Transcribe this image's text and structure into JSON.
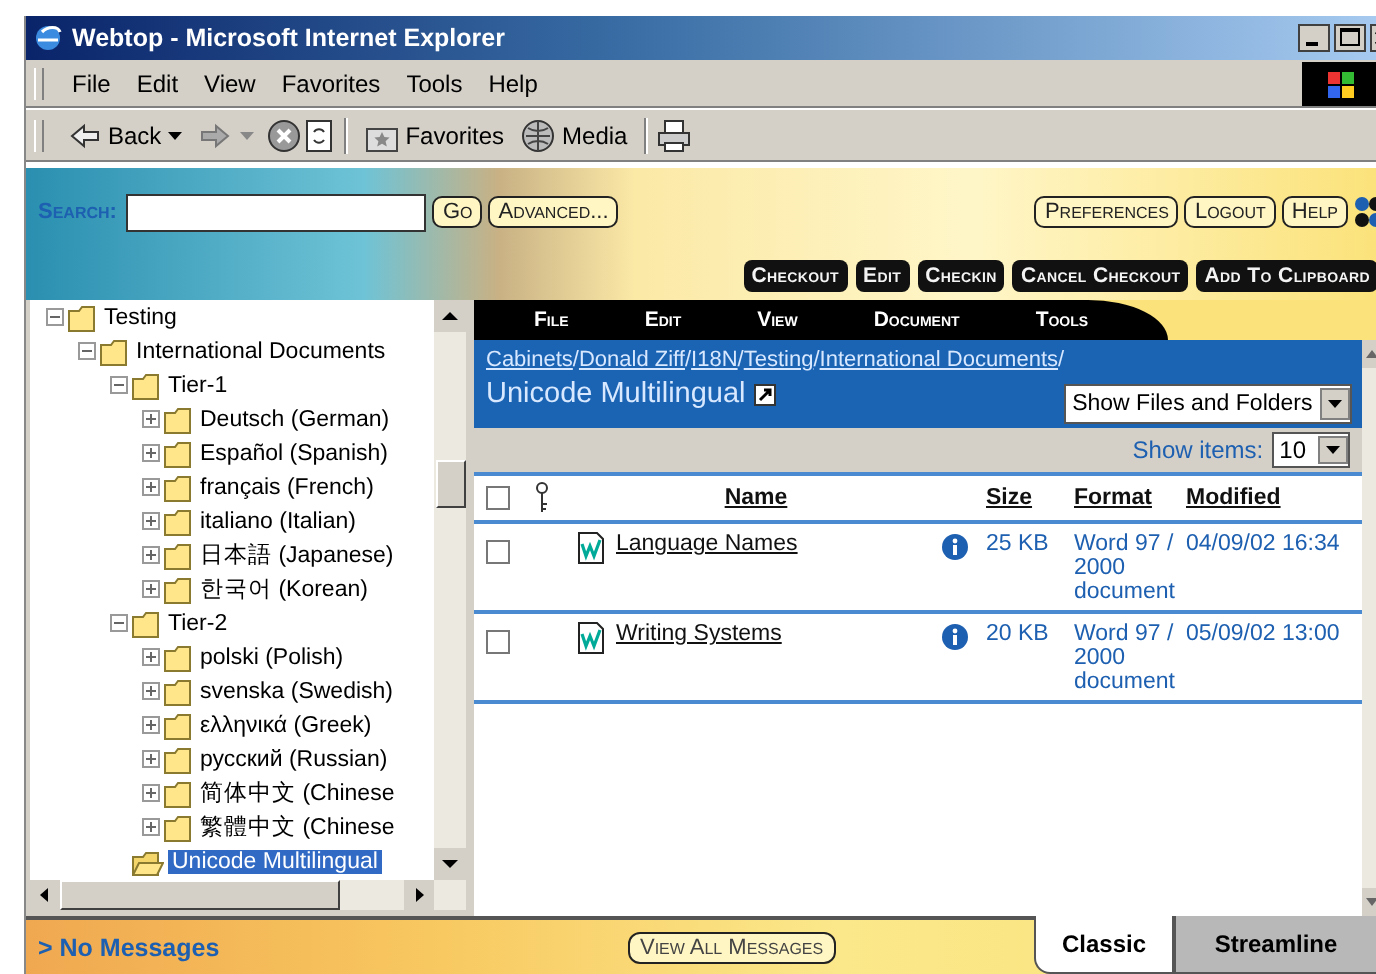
{
  "window": {
    "title": "Webtop - Microsoft Internet Explorer"
  },
  "menu_bar": [
    "File",
    "Edit",
    "View",
    "Favorites",
    "Tools",
    "Help"
  ],
  "toolbar": [
    {
      "kind": "back",
      "label": "Back"
    },
    {
      "kind": "forward"
    },
    {
      "kind": "stop"
    },
    {
      "kind": "refresh"
    },
    {
      "kind": "favorites",
      "label": "Favorites"
    },
    {
      "kind": "media",
      "label": "Media"
    },
    {
      "kind": "print"
    }
  ],
  "header": {
    "search": {
      "label": "Search:",
      "button": "Go",
      "advanced": "Advanced..."
    },
    "links": [
      "Preferences",
      "Logout",
      "Help"
    ],
    "actions": [
      "Checkout",
      "Edit",
      "Checkin",
      "Cancel Checkout",
      "Add To Clipboard"
    ]
  },
  "tree": [
    {
      "label": "Testing",
      "kind": "folder",
      "expanded": true,
      "selected": false,
      "children": [
        {
          "label": "International Documents",
          "kind": "folder",
          "expanded": true,
          "selected": false,
          "children": [
            {
              "label": "Tier-1",
              "kind": "folder",
              "expanded": true,
              "selected": false,
              "children": [
                {
                  "label": "Deutsch (German)",
                  "kind": "folder",
                  "expanded": false,
                  "selected": false
                },
                {
                  "label": "Español (Spanish)",
                  "kind": "folder",
                  "expanded": false,
                  "selected": false
                },
                {
                  "label": "français (French)",
                  "kind": "folder",
                  "expanded": false,
                  "selected": false
                },
                {
                  "label": "italiano (Italian)",
                  "kind": "folder",
                  "expanded": false,
                  "selected": false
                },
                {
                  "label": "日本語 (Japanese)",
                  "kind": "folder",
                  "expanded": false,
                  "selected": false
                },
                {
                  "label": "한국어 (Korean)",
                  "kind": "folder",
                  "expanded": false,
                  "selected": false
                }
              ]
            },
            {
              "label": "Tier-2",
              "kind": "folder",
              "expanded": true,
              "selected": false,
              "children": [
                {
                  "label": "polski (Polish)",
                  "kind": "folder",
                  "expanded": false,
                  "selected": false
                },
                {
                  "label": "svenska (Swedish)",
                  "kind": "folder",
                  "expanded": false,
                  "selected": false
                },
                {
                  "label": "ελληνικά (Greek)",
                  "kind": "folder",
                  "expanded": false,
                  "selected": false
                },
                {
                  "label": "русский (Russian)",
                  "kind": "folder",
                  "expanded": false,
                  "selected": false
                },
                {
                  "label": "简体中文 (Chinese",
                  "kind": "folder",
                  "expanded": false,
                  "selected": false
                },
                {
                  "label": "繁體中文 (Chinese",
                  "kind": "folder",
                  "expanded": false,
                  "selected": false
                }
              ]
            },
            {
              "label": "Unicode Multilingual",
              "kind": "leaf",
              "selected": true
            }
          ]
        }
      ]
    }
  ],
  "content": {
    "menu": [
      "File",
      "Edit",
      "View",
      "Document",
      "Tools"
    ],
    "breadcrumb": {
      "separator": "/",
      "links": [
        "Cabinets",
        "Donald Ziff",
        "I18N",
        "Testing",
        "International Documents"
      ]
    },
    "title": "Unicode Multilingual",
    "filter": "Show Files and Folders",
    "show_items": {
      "label": "Show items:",
      "value": "10"
    },
    "select_all_checked": false,
    "columns": [
      "Name",
      "Size",
      "Format",
      "Modified"
    ],
    "rows": [
      {
        "checked": false,
        "name": "Language Names",
        "size": "25 KB",
        "format": "Word 97 / 2000 document",
        "modified": "04/09/02 16:34"
      },
      {
        "checked": false,
        "name": "Writing Systems",
        "size": "20 KB",
        "format": "Word 97 / 2000 document",
        "modified": "05/09/02 13:00"
      }
    ]
  },
  "footer": {
    "messages": "> No Messages",
    "view_all": "View All Messages",
    "tabs": [
      {
        "label": "Classic",
        "selected": true
      },
      {
        "label": "Streamline",
        "selected": false
      }
    ]
  }
}
